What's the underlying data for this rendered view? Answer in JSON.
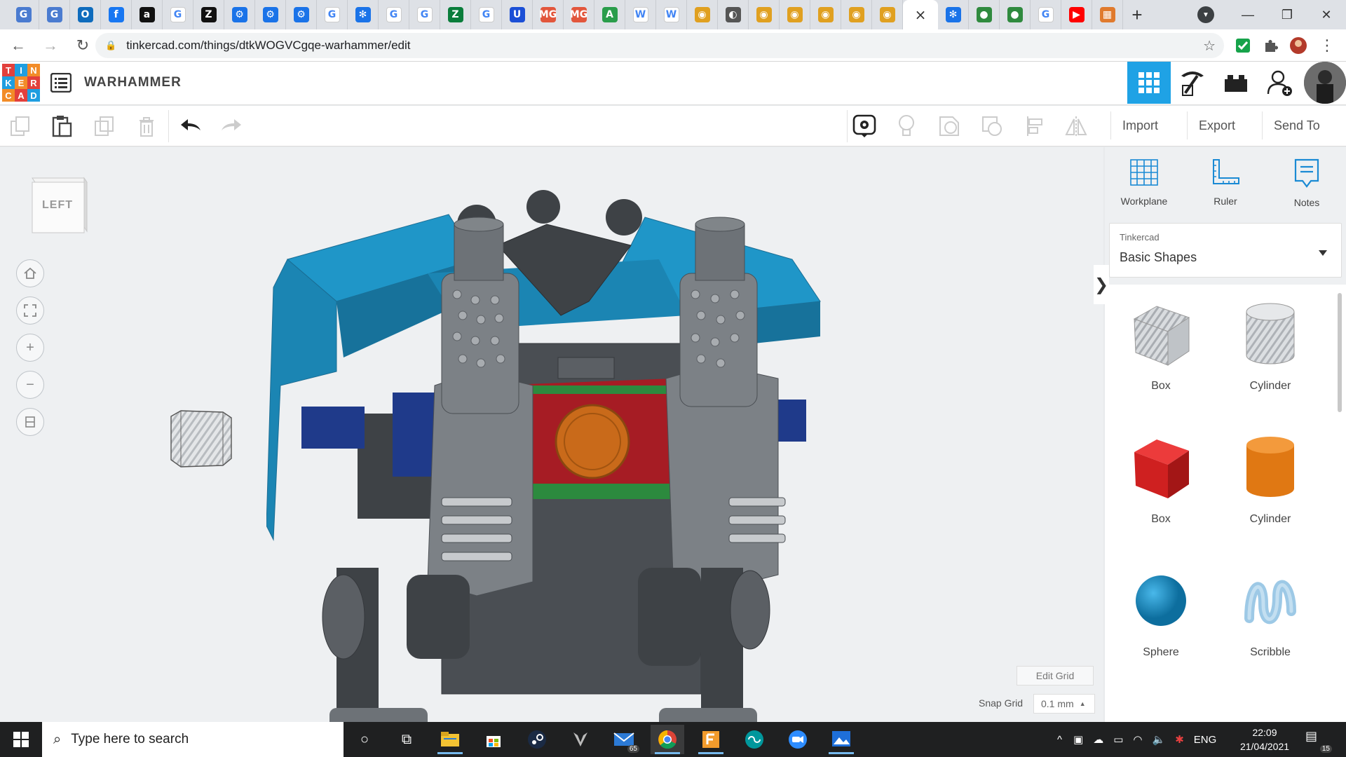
{
  "browser": {
    "tabs": [
      {
        "icon": "google-docs-icon",
        "glyph": "G",
        "color": "#4a7bd0"
      },
      {
        "icon": "google-docs-icon",
        "glyph": "G",
        "color": "#4a7bd0"
      },
      {
        "icon": "outlook-icon",
        "glyph": "O",
        "color": "#0f6cbd"
      },
      {
        "icon": "facebook-icon",
        "glyph": "f",
        "color": "#1877f2"
      },
      {
        "icon": "amazon-icon",
        "glyph": "a",
        "color": "#111111"
      },
      {
        "icon": "google-icon",
        "glyph": "G",
        "color": "#ffffff"
      },
      {
        "icon": "z-icon",
        "glyph": "Z",
        "color": "#111111"
      },
      {
        "icon": "gear-blue-icon",
        "glyph": "⚙",
        "color": "#1a73e8"
      },
      {
        "icon": "gear-blue-icon",
        "glyph": "⚙",
        "color": "#1a73e8"
      },
      {
        "icon": "gear-blue-icon",
        "glyph": "⚙",
        "color": "#1a73e8"
      },
      {
        "icon": "google-icon",
        "glyph": "G",
        "color": "#ffffff"
      },
      {
        "icon": "snowflake-icon",
        "glyph": "✻",
        "color": "#1a73e8"
      },
      {
        "icon": "google-icon",
        "glyph": "G",
        "color": "#ffffff"
      },
      {
        "icon": "google-icon",
        "glyph": "G",
        "color": "#ffffff"
      },
      {
        "icon": "zotero-icon",
        "glyph": "Z",
        "color": "#0a7d3b"
      },
      {
        "icon": "google-icon",
        "glyph": "G",
        "color": "#ffffff"
      },
      {
        "icon": "u-icon",
        "glyph": "U",
        "color": "#1b4fd6"
      },
      {
        "icon": "mg-icon",
        "glyph": "MG",
        "color": "#e2563c"
      },
      {
        "icon": "mg-icon",
        "glyph": "MG",
        "color": "#e2563c"
      },
      {
        "icon": "drive-icon",
        "glyph": "A",
        "color": "#2a9d4b"
      },
      {
        "icon": "wikipedia-icon",
        "glyph": "W",
        "color": "#ffffff"
      },
      {
        "icon": "wikipedia-icon",
        "glyph": "W",
        "color": "#ffffff"
      },
      {
        "icon": "crab-icon",
        "glyph": "◉",
        "color": "#e0a020"
      },
      {
        "icon": "globe-icon",
        "glyph": "◐",
        "color": "#555555"
      },
      {
        "icon": "crab-icon",
        "glyph": "◉",
        "color": "#e0a020"
      },
      {
        "icon": "crab-icon",
        "glyph": "◉",
        "color": "#e0a020"
      },
      {
        "icon": "crab-icon",
        "glyph": "◉",
        "color": "#e0a020"
      },
      {
        "icon": "crab-icon",
        "glyph": "◉",
        "color": "#e0a020"
      },
      {
        "icon": "crab-icon",
        "glyph": "◉",
        "color": "#e0a020"
      }
    ],
    "active_tab_glyph": "×",
    "tabs_after": [
      {
        "icon": "snowflake-icon",
        "glyph": "✻",
        "color": "#1a73e8"
      },
      {
        "icon": "circle-green-icon",
        "glyph": "●",
        "color": "#2f8a3e"
      },
      {
        "icon": "circle-green-icon",
        "glyph": "●",
        "color": "#2f8a3e"
      },
      {
        "icon": "google-icon",
        "glyph": "G",
        "color": "#ffffff"
      },
      {
        "icon": "youtube-icon",
        "glyph": "▶",
        "color": "#ff0000"
      },
      {
        "icon": "grid-colorful-icon",
        "glyph": "▦",
        "color": "#e07a2d"
      }
    ],
    "new_tab": "+",
    "window_controls": {
      "minimize": "—",
      "maximize": "❐",
      "close": "✕"
    },
    "url": "tinkercad.com/things/dtkWOGVCgqe-warhammer/edit"
  },
  "tinkercad": {
    "logo_letters": [
      "T",
      "I",
      "N",
      "K",
      "E",
      "R",
      "C",
      "A",
      "D"
    ],
    "logo_colors": [
      "#e2403c",
      "#1f9ee0",
      "#f28c28",
      "#1f9ee0",
      "#f28c28",
      "#e2403c",
      "#f28c28",
      "#e2403c",
      "#1f9ee0"
    ],
    "project_title": "WARHAMMER",
    "toolbar": {
      "import": "Import",
      "export": "Export",
      "send_to": "Send To"
    },
    "viewcube_label": "LEFT",
    "panel_tools": [
      "Workplane",
      "Ruler",
      "Notes"
    ],
    "library_caption": "Tinkercad",
    "library_value": "Basic Shapes",
    "shapes": [
      {
        "label": "Box",
        "kind": "box-hole"
      },
      {
        "label": "Cylinder",
        "kind": "cylinder-hole"
      },
      {
        "label": "Box",
        "kind": "box-solid"
      },
      {
        "label": "Cylinder",
        "kind": "cylinder-solid"
      },
      {
        "label": "Sphere",
        "kind": "sphere"
      },
      {
        "label": "Scribble",
        "kind": "scribble"
      }
    ],
    "edit_grid": "Edit Grid",
    "snap_grid_label": "Snap Grid",
    "snap_grid_value": "0.1 mm"
  },
  "taskbar": {
    "search_placeholder": "Type here to search",
    "mail_badge": "65",
    "language": "ENG",
    "time": "22:09",
    "date": "21/04/2021",
    "notifications": "15"
  }
}
